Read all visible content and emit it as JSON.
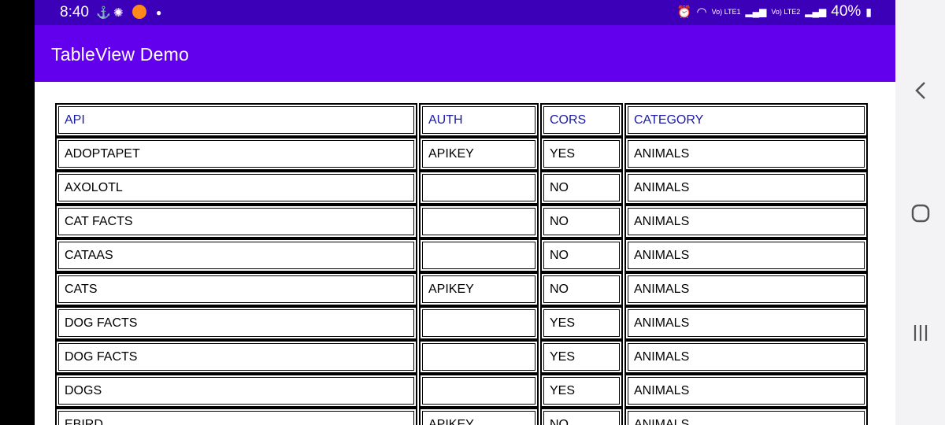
{
  "status": {
    "time": "8:40",
    "network1": "Vo) LTE1",
    "network2": "Vo) LTE2",
    "battery": "40%"
  },
  "appbar": {
    "title": "TableView Demo"
  },
  "table": {
    "headers": [
      "API",
      "AUTH",
      "CORS",
      "CATEGORY"
    ],
    "rows": [
      [
        "ADOPTAPET",
        "APIKEY",
        "YES",
        "ANIMALS"
      ],
      [
        "AXOLOTL",
        "",
        "NO",
        "ANIMALS"
      ],
      [
        "CAT FACTS",
        "",
        "NO",
        "ANIMALS"
      ],
      [
        "CATAAS",
        "",
        "NO",
        "ANIMALS"
      ],
      [
        "CATS",
        "APIKEY",
        "NO",
        "ANIMALS"
      ],
      [
        "DOG FACTS",
        "",
        "YES",
        "ANIMALS"
      ],
      [
        "DOG FACTS",
        "",
        "YES",
        "ANIMALS"
      ],
      [
        "DOGS",
        "",
        "YES",
        "ANIMALS"
      ],
      [
        "EBIRD",
        "APIKEY",
        "NO",
        "ANIMALS"
      ]
    ]
  },
  "nav": {
    "back_icon": "chevron-left-icon",
    "home_icon": "home-icon",
    "recents_icon": "recents-icon"
  },
  "colors": {
    "status_bar": "#3c00b8",
    "app_bar": "#6200ee",
    "header_text": "#1a1aa6"
  }
}
